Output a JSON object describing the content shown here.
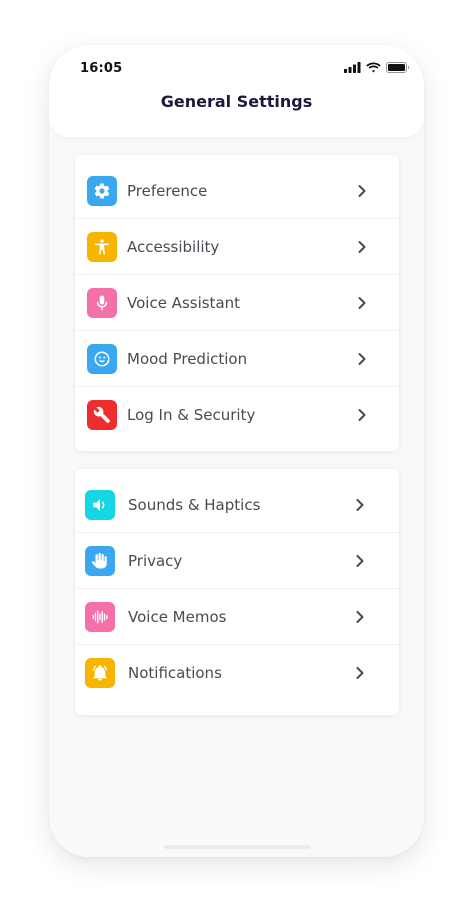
{
  "status_bar": {
    "time": "16:05"
  },
  "header": {
    "title": "General Settings"
  },
  "groups": [
    {
      "items": [
        {
          "label": "Preference",
          "icon": "gear-icon",
          "color": "#3aa8f0"
        },
        {
          "label": "Accessibility",
          "icon": "accessibility-icon",
          "color": "#f7b500"
        },
        {
          "label": "Voice Assistant",
          "icon": "microphone-icon",
          "color": "#f56fa8"
        },
        {
          "label": "Mood Prediction",
          "icon": "smiley-icon",
          "color": "#3aa8f0"
        },
        {
          "label": "Log In & Security",
          "icon": "wrench-icon",
          "color": "#ee2d2d"
        }
      ]
    },
    {
      "items": [
        {
          "label": "Sounds & Haptics",
          "icon": "speaker-icon",
          "color": "#16d6e3"
        },
        {
          "label": "Privacy",
          "icon": "hand-icon",
          "color": "#3aa8f0"
        },
        {
          "label": "Voice Memos",
          "icon": "waveform-icon",
          "color": "#f56fa8"
        },
        {
          "label": "Notifications",
          "icon": "bell-icon",
          "color": "#f7b500"
        }
      ]
    }
  ]
}
